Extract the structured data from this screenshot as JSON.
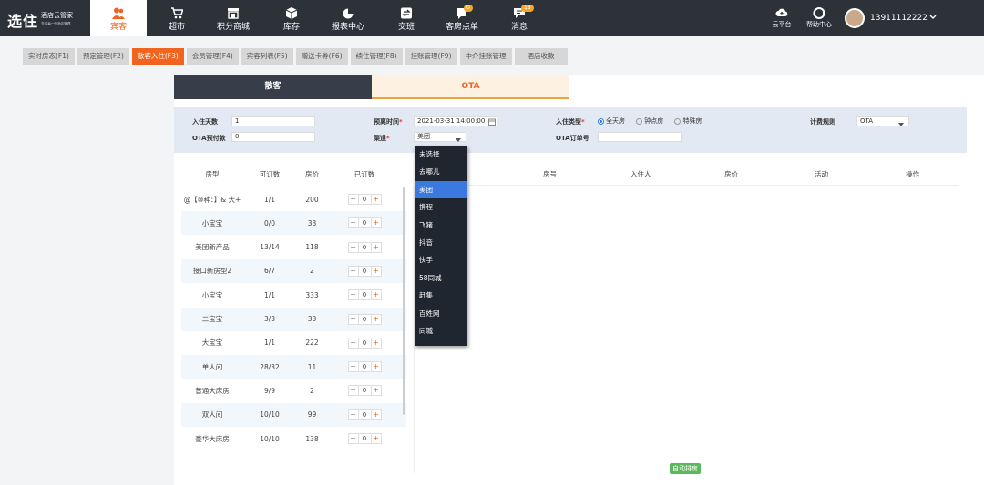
{
  "brand": {
    "name": "选住",
    "sub": "酒店云管家",
    "tagline": "节省每一份酒店管理"
  },
  "nav": [
    {
      "label": "宾客",
      "icon": "guest-icon",
      "active": true
    },
    {
      "label": "超市",
      "icon": "cart-icon"
    },
    {
      "label": "积分商城",
      "icon": "store-icon"
    },
    {
      "label": "库存",
      "icon": "box-icon"
    },
    {
      "label": "报表中心",
      "icon": "report-icon"
    },
    {
      "label": "交班",
      "icon": "handover-icon"
    },
    {
      "label": "客房点单",
      "icon": "order-icon",
      "badge": "0"
    },
    {
      "label": "消息",
      "icon": "message-icon",
      "badge": "18"
    }
  ],
  "right_nav": [
    {
      "label": "云平台",
      "icon": "cloud-upload-icon"
    },
    {
      "label": "帮助中心",
      "icon": "help-icon"
    }
  ],
  "user": {
    "phone": "13911112222"
  },
  "subtabs": [
    {
      "label": "实时房态(F1)"
    },
    {
      "label": "预定管理(F2)"
    },
    {
      "label": "散客入住(F3)",
      "active": true
    },
    {
      "label": "会员管理(F4)"
    },
    {
      "label": "宾客列表(F5)"
    },
    {
      "label": "赠送卡券(F6)"
    },
    {
      "label": "续住管理(F8)"
    },
    {
      "label": "挂账管理(F9)"
    },
    {
      "label": "中介挂账管理"
    },
    {
      "label": "酒店收款"
    }
  ],
  "mode_tabs": {
    "walkin": "散客",
    "ota": "OTA"
  },
  "form": {
    "stay_days_label": "入住天数",
    "stay_days_value": "1",
    "ota_prepay_label": "OTA预付款",
    "ota_prepay_value": "0",
    "checkout_time_label": "预离时间",
    "checkout_time_value": "2021-03-31 14:00:00",
    "channel_label": "渠道",
    "channel_value": "美团",
    "checkin_type_label": "入住类型",
    "checkin_types": [
      "全天房",
      "钟点房",
      "特殊房"
    ],
    "ota_order_label": "OTA订单号",
    "ota_order_value": "",
    "billing_rule_label": "计费规则",
    "billing_rule_value": "OTA"
  },
  "room_table": {
    "headers": [
      "房型",
      "可订数",
      "房价",
      "已订数"
    ],
    "rows": [
      {
        "type": "@【⑩种：】& 大+",
        "available": "1/1",
        "price": "200",
        "booked": "0"
      },
      {
        "type": "小宝宝",
        "available": "0/0",
        "price": "33",
        "booked": "0"
      },
      {
        "type": "美团新产品",
        "available": "13/14",
        "price": "118",
        "booked": "0"
      },
      {
        "type": "接口新房型2",
        "available": "6/7",
        "price": "2",
        "booked": "0"
      },
      {
        "type": "小宝宝",
        "available": "1/1",
        "price": "333",
        "booked": "0"
      },
      {
        "type": "二宝宝",
        "available": "3/3",
        "price": "33",
        "booked": "0"
      },
      {
        "type": "大宝宝",
        "available": "1/1",
        "price": "222",
        "booked": "0"
      },
      {
        "type": "单人间",
        "available": "28/32",
        "price": "11",
        "booked": "0"
      },
      {
        "type": "普通大床房",
        "available": "9/9",
        "price": "2",
        "booked": "0"
      },
      {
        "type": "双人间",
        "available": "10/10",
        "price": "99",
        "booked": "0"
      },
      {
        "type": "豪华大床房",
        "available": "10/10",
        "price": "138",
        "booked": "0"
      }
    ]
  },
  "right_table": {
    "headers": [
      "房号",
      "入住人",
      "房价",
      "活动",
      "操作"
    ]
  },
  "auto_assign_label": "自动排房",
  "channel_options": [
    "未选择",
    "去哪儿",
    "美团",
    "携程",
    "飞猪",
    "抖音",
    "快手",
    "58同城",
    "赶集",
    "百姓网",
    "同城"
  ],
  "channel_selected_index": 2,
  "colors": {
    "accent": "#f0641e",
    "nav_bg": "#2d3138",
    "select_blue": "#3a7ae0"
  }
}
